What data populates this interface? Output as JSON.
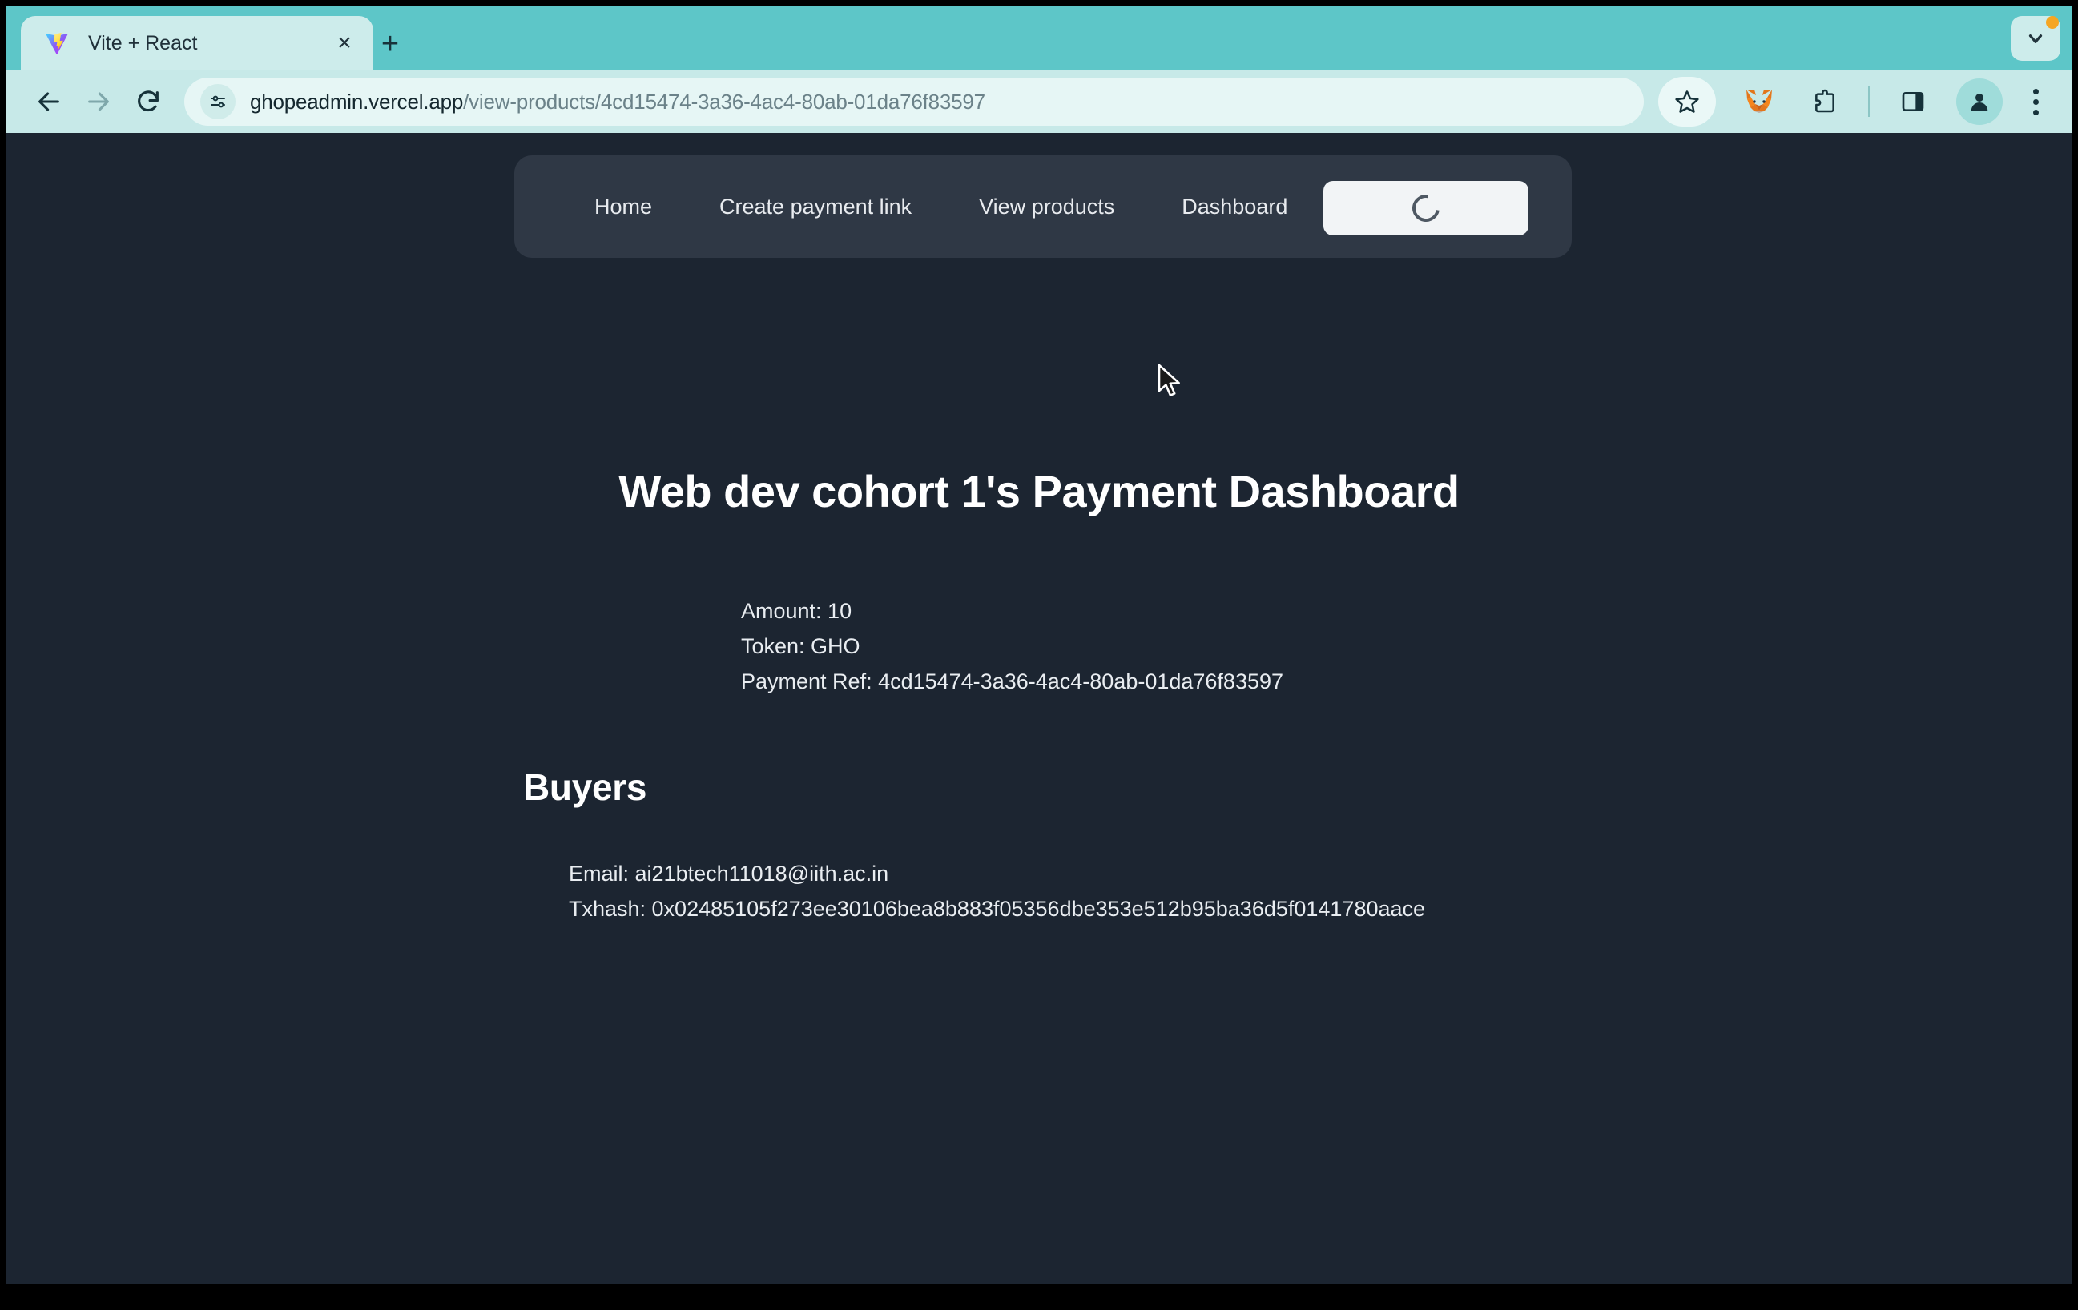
{
  "browser": {
    "tab": {
      "title": "Vite + React",
      "favicon": "vite-logo-icon",
      "close_label": "×"
    },
    "new_tab_label": "+",
    "window_controls": {
      "chevron": "chevron-down-icon",
      "update_badge": true
    },
    "toolbar": {
      "back": "back-arrow-icon",
      "forward": "forward-arrow-icon",
      "reload": "reload-icon",
      "site_settings": "tune-icon",
      "bookmark": "star-icon",
      "metamask": "metamask-fox-icon",
      "extensions": "puzzle-icon",
      "side_panel": "side-panel-icon",
      "profile": "avatar-icon",
      "menu": "three-dot-menu-icon"
    },
    "address": {
      "host": "ghopeadmin.vercel.app",
      "path": "/view-products/4cd15474-3a36-4ac4-80ab-01da76f83597",
      "full": "ghopeadmin.vercel.app/view-products/4cd15474-3a36-4ac4-80ab-01da76f83597"
    }
  },
  "page": {
    "nav": {
      "links": [
        {
          "label": "Home"
        },
        {
          "label": "Create payment link"
        },
        {
          "label": "View products"
        },
        {
          "label": "Dashboard"
        }
      ],
      "connect_button": {
        "state": "loading",
        "icon": "spinner-icon",
        "label": ""
      }
    },
    "title": "Web dev cohort 1's Payment Dashboard",
    "details": {
      "amount_line": "Amount: 10",
      "token_line": "Token: GHO",
      "payment_ref_line": "Payment Ref: 4cd15474-3a36-4ac4-80ab-01da76f83597",
      "amount": "10",
      "token": "GHO",
      "payment_ref": "4cd15474-3a36-4ac4-80ab-01da76f83597"
    },
    "buyers_heading": "Buyers",
    "buyers": [
      {
        "email_line": "Email: ai21btech11018@iith.ac.in",
        "txhash_line": "Txhash: 0x02485105f273ee30106bea8b883f05356dbe353e512b95ba36d5f0141780aace",
        "email": "ai21btech11018@iith.ac.in",
        "txhash": "0x02485105f273ee30106bea8b883f05356dbe353e512b95ba36d5f0141780aace"
      }
    ]
  },
  "colors": {
    "browser_accent": "#5dc6c8",
    "toolbar": "#c7e9e8",
    "page_background": "#1c2531",
    "nav_background": "#2f3845",
    "button_white": "#f2f4f6",
    "text_primary": "#ffffff",
    "text_body": "#e9edf1",
    "badge_orange": "#f5a623"
  }
}
